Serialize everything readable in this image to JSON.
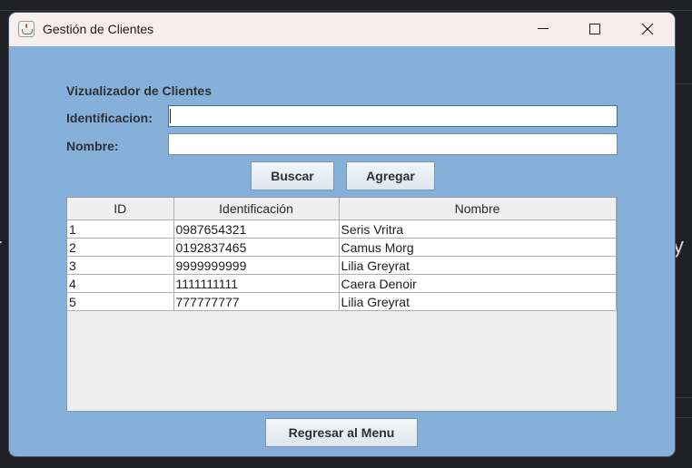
{
  "window": {
    "title": "Gestión de Clientes"
  },
  "form": {
    "heading": "Vizualizador de Clientes",
    "identificacion_label": "Identificacion:",
    "identificacion_value": "",
    "nombre_label": "Nombre:",
    "nombre_value": "",
    "buscar_label": "Buscar",
    "agregar_label": "Agregar",
    "regresar_label": "Regresar al Menu"
  },
  "table": {
    "columns": [
      "ID",
      "Identificación",
      "Nombre"
    ],
    "rows": [
      [
        "1",
        "0987654321",
        "Seris Vritra"
      ],
      [
        "2",
        "0192837465",
        "Camus Morg"
      ],
      [
        "3",
        "9999999999",
        "Lilia Greyrat"
      ],
      [
        "4",
        "1111111111",
        "Caera Denoir"
      ],
      [
        "5",
        "777777777",
        "Lilia Greyrat"
      ]
    ]
  },
  "colors": {
    "window_bg": "#85b0d9",
    "titlebar_bg": "#f9eeee"
  },
  "icons": {
    "app": "java-cup-icon",
    "minimize": "minimize-icon",
    "maximize": "maximize-icon",
    "close": "close-icon"
  }
}
